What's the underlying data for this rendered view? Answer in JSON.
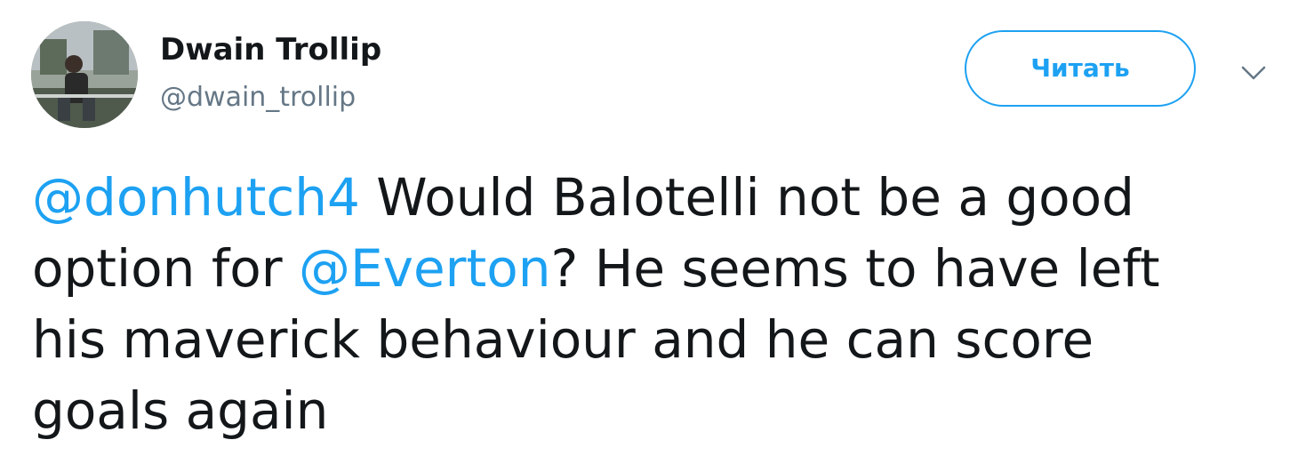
{
  "author": {
    "display_name": "Dwain Trollip",
    "handle": "@dwain_trollip",
    "avatar_icon": "user-avatar-photo"
  },
  "follow_button": {
    "label": "Читать"
  },
  "menu": {
    "icon": "chevron-down-icon"
  },
  "tweet": {
    "line1": {
      "mention": "@donhutch4",
      "text": " Would Balotelli not be a good"
    },
    "line2": {
      "text_before": "option for ",
      "mention": "@Everton",
      "text_after": "? He seems to have left"
    },
    "line3": {
      "text": "his maverick behaviour and he can score"
    },
    "line4": {
      "text": "goals again"
    }
  },
  "colors": {
    "accent": "#1da1f2",
    "text": "#14171a",
    "secondary_text": "#657786",
    "background": "#ffffff"
  }
}
